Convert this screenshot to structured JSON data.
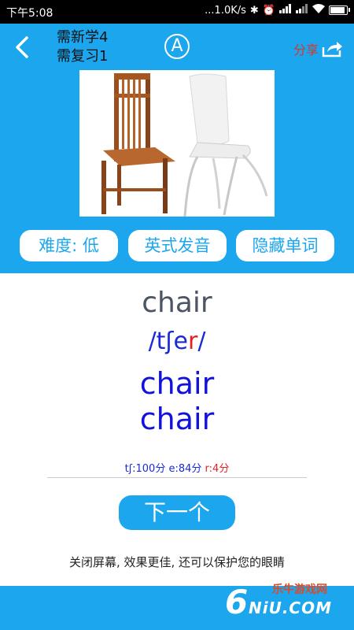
{
  "status_bar": {
    "time": "下午5:08",
    "net": "...1.0K/s"
  },
  "header": {
    "new_count": "需新学4",
    "review_count": "需复习1",
    "mode_letter": "A",
    "share_label": "分享"
  },
  "image": {
    "alt": "chair"
  },
  "buttons": {
    "difficulty": "难度: 低",
    "accent": "英式发音",
    "hide_word": "隐藏单词",
    "next": "下一个"
  },
  "word": {
    "text": "chair",
    "phonetic_start": "/tʃe",
    "phonetic_highlight": "r",
    "phonetic_end": "/",
    "spelling_1": "chair",
    "spelling_2": "chair"
  },
  "scores": {
    "s1": "tʃ:100分",
    "s2": "e:84分",
    "s3": "r:4分"
  },
  "tip": "关闭屏幕, 效果更佳, 还可以保护您的眼睛",
  "watermark": {
    "text": "乐牛游戏网",
    "domain": "NiU.COM"
  },
  "colors": {
    "primary": "#1ba6ee",
    "word_blue": "#1212d9",
    "highlight_red": "#e02222"
  }
}
